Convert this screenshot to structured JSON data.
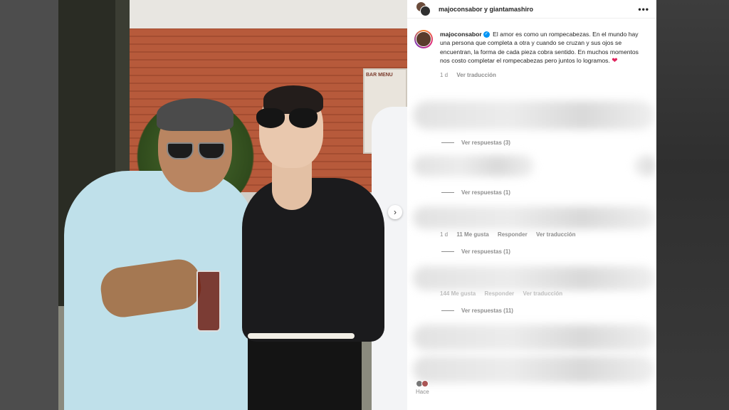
{
  "header": {
    "names": "majoconsabor y giantamashiro",
    "more_glyph": "•••"
  },
  "caption": {
    "username": "majoconsabor",
    "text": "El amor es como un rompecabezas. En el mundo hay una persona que completa a otra y cuando se cruzan y sus ojos se encuentran, la forma de cada pieza cobra sentido. En muchos momentos nos costo completar el rompecabezas pero juntos lo logramos.",
    "emoji": "❤",
    "time": "1 d",
    "translate": "Ver traducción"
  },
  "photo": {
    "sign_text": "BAR MENU"
  },
  "comments": [
    {
      "replies": "Ver respuestas (3)"
    },
    {
      "replies": "Ver respuestas (1)"
    },
    {
      "time": "1 d",
      "likes": "11 Me gusta",
      "reply": "Responder",
      "translate": "Ver traducción",
      "replies": "Ver respuestas (1)"
    },
    {
      "likes": "144 Me gusta",
      "reply": "Responder",
      "translate": "Ver traducción",
      "replies": "Ver respuestas (11)"
    }
  ],
  "footer": {
    "text": "Hace"
  },
  "nav": {
    "next_glyph": "›"
  },
  "icons": [
    "more-icon",
    "verified-icon",
    "heart-icon",
    "chevron-right-icon"
  ]
}
